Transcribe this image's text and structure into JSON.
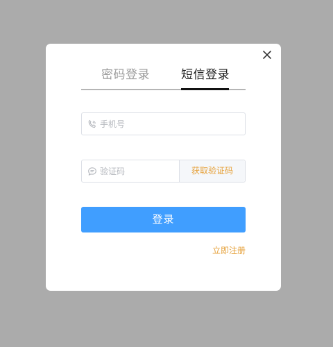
{
  "modal": {
    "tabs": [
      {
        "label": "密码登录",
        "active": false
      },
      {
        "label": "短信登录",
        "active": true
      }
    ],
    "phone_field": {
      "placeholder": "手机号",
      "value": "",
      "icon": "phone-icon"
    },
    "code_field": {
      "placeholder": "验证码",
      "value": "",
      "icon": "message-icon"
    },
    "get_code_label": "获取验证码",
    "login_label": "登录",
    "register_label": "立即注册"
  },
  "colors": {
    "overlay": "#ababab",
    "primary": "#409eff",
    "accent": "#e6a23c",
    "active_tab": "#1d1d1d",
    "inactive_tab": "#9b9b9b"
  }
}
